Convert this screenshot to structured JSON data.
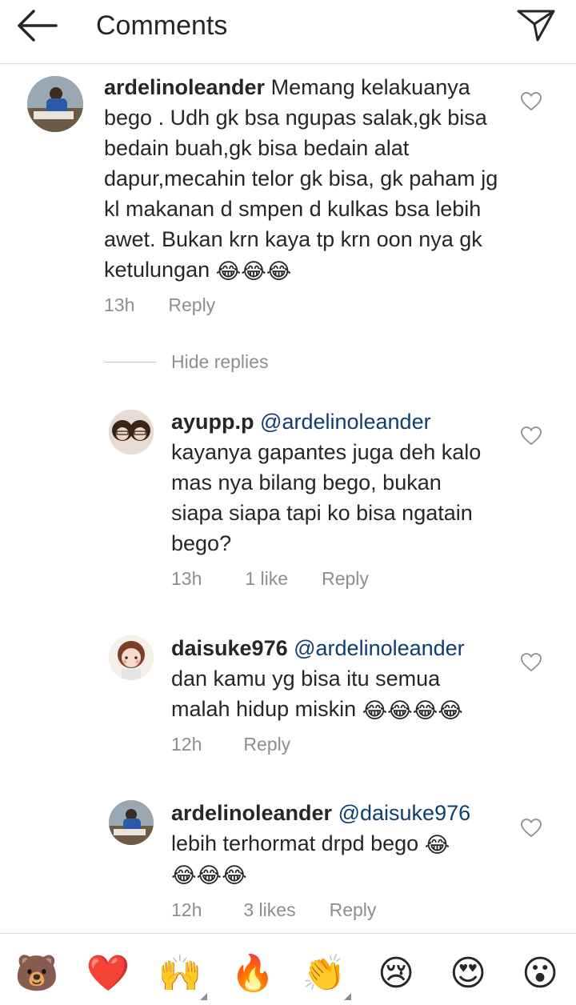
{
  "header": {
    "title": "Comments"
  },
  "comments": [
    {
      "username": "ardelinoleander",
      "mention": "",
      "body": "Memang kelakuanya bego . Udh gk bsa ngupas salak,gk bisa bedain buah,gk bisa bedain alat dapur,mecahin telor gk bisa, gk paham jg kl makanan d smpen d kulkas bsa lebih awet. Bukan krn kaya tp krn oon nya gk ketulungan",
      "emoji": "😂😂😂",
      "time": "13h",
      "likes": "",
      "reply": "Reply"
    }
  ],
  "hide_replies": "Hide replies",
  "replies": [
    {
      "username": "ayupp.p",
      "mention": "@ardelinoleander",
      "body": "kayanya gapantes juga deh kalo mas nya bilang bego, bukan siapa siapa tapi ko bisa ngatain bego?",
      "emoji": "",
      "time": "13h",
      "likes": "1 like",
      "reply": "Reply"
    },
    {
      "username": "daisuke976",
      "mention": "@ardelinoleander",
      "body": "dan kamu yg bisa itu semua malah hidup miskin",
      "emoji": "😂😂😂😂",
      "time": "12h",
      "likes": "",
      "reply": "Reply"
    },
    {
      "username": "ardelinoleander",
      "mention": "@daisuke976",
      "body": "lebih terhormat drpd bego",
      "emoji": "😂",
      "emoji2": "😂😂😂",
      "time": "12h",
      "likes": "3 likes",
      "reply": "Reply"
    }
  ],
  "emoji_bar": [
    "🐻",
    "❤️",
    "🙌",
    "🔥",
    "👏",
    "😢",
    "😍",
    "😮"
  ],
  "colors": {
    "mention": "#0f3d6e",
    "meta": "#8e8e8e",
    "text": "#262626"
  }
}
